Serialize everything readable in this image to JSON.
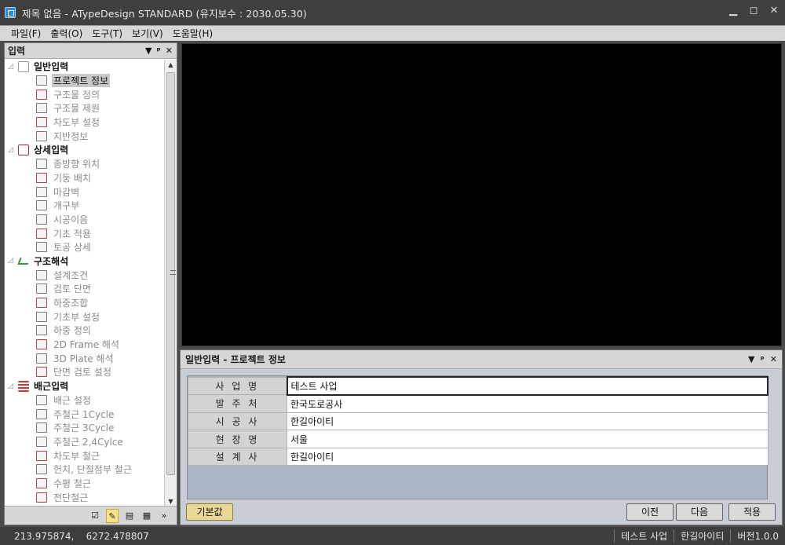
{
  "window": {
    "title": "제목 없음 - ATypeDesign STANDARD  (유지보수 : 2030.05.30)"
  },
  "menu": [
    "파일(F)",
    "출력(O)",
    "도구(T)",
    "보기(V)",
    "도움말(H)"
  ],
  "left_panel": {
    "title": "입력",
    "tree": [
      {
        "label": "일반입력",
        "icon": "document-icon",
        "children": [
          "프로젝트 정보",
          "구조물 정의",
          "구조물 제원",
          "차도부 설정",
          "지반정보"
        ]
      },
      {
        "label": "상세입력",
        "icon": "computer-icon",
        "children": [
          "종방향 위치",
          "기둥 배치",
          "마감벽",
          "개구부",
          "시공이음",
          "기초 적용",
          "토공 상세"
        ]
      },
      {
        "label": "구조해석",
        "icon": "chart-icon",
        "children": [
          "설계조건",
          "검토 단면",
          "하중조합",
          "기초부 설정",
          "하중 정의",
          "2D Frame 해석",
          "3D Plate 해석",
          "단면 검토 설정"
        ]
      },
      {
        "label": "배근입력",
        "icon": "rebar-icon",
        "children": [
          "배근 설정",
          "주철근 1Cycle",
          "주철근 3Cycle",
          "주철근 2,4Cylce",
          "차도부 철근",
          "헌치, 단절점부 철근",
          "수평 철근",
          "전단철근"
        ]
      }
    ],
    "selected": "프로젝트 정보"
  },
  "props_panel": {
    "title": "일반입력 - 프로젝트 정보",
    "rows": [
      {
        "key": "사 업 명",
        "value": "테스트 사업"
      },
      {
        "key": "발 주 처",
        "value": "한국도로공사"
      },
      {
        "key": "시 공 사",
        "value": "한길아이티"
      },
      {
        "key": "현 장 명",
        "value": "서울"
      },
      {
        "key": "설 계 사",
        "value": "한길아이티"
      }
    ],
    "default_button": "기본값",
    "prev_button": "이전",
    "next_button": "다음",
    "apply_button": "적용"
  },
  "status": {
    "coords": "213.975874,    6272.478807",
    "project": "테스트 사업",
    "company": "한길아이티",
    "version": "버전1.0.0"
  }
}
